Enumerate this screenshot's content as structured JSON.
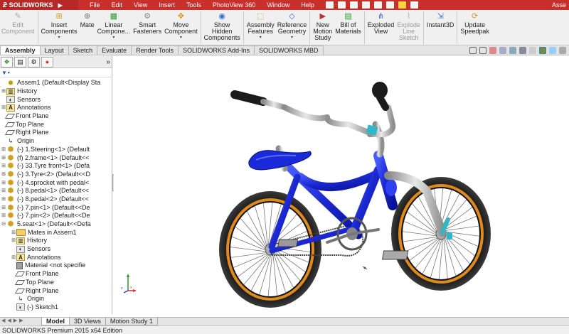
{
  "app": {
    "logo": "SOLIDWORKS",
    "title_right": "Asse"
  },
  "menus": [
    "File",
    "Edit",
    "View",
    "Insert",
    "Tools",
    "PhotoView 360",
    "Window",
    "Help"
  ],
  "commands": [
    {
      "id": "edit-component",
      "label": "Edit\nComponent",
      "disabled": true,
      "icon": "edit-component-icon"
    },
    {
      "id": "insert-components",
      "label": "Insert\nComponents",
      "disabled": false,
      "icon": "insert-components-icon",
      "dropdown": true
    },
    {
      "id": "mate",
      "label": "Mate",
      "disabled": false,
      "icon": "mate-icon"
    },
    {
      "id": "linear-component",
      "label": "Linear\nCompone...",
      "disabled": false,
      "icon": "linear-pattern-icon",
      "dropdown": true
    },
    {
      "id": "smart-fasteners",
      "label": "Smart\nFasteners",
      "disabled": false,
      "icon": "smart-fasteners-icon"
    },
    {
      "id": "move-component",
      "label": "Move\nComponent",
      "disabled": false,
      "icon": "move-component-icon",
      "dropdown": true
    },
    {
      "id": "show-hidden",
      "label": "Show\nHidden\nComponents",
      "disabled": false,
      "icon": "show-hidden-icon"
    },
    {
      "id": "assembly-features",
      "label": "Assembly\nFeatures",
      "disabled": false,
      "icon": "assembly-features-icon",
      "dropdown": true
    },
    {
      "id": "reference-geometry",
      "label": "Reference\nGeometry",
      "disabled": false,
      "icon": "reference-geometry-icon",
      "dropdown": true
    },
    {
      "id": "new-motion-study",
      "label": "New\nMotion\nStudy",
      "disabled": false,
      "icon": "motion-study-icon"
    },
    {
      "id": "bill-of-materials",
      "label": "Bill of\nMaterials",
      "disabled": false,
      "icon": "bom-icon"
    },
    {
      "id": "exploded-view",
      "label": "Exploded\nView",
      "disabled": false,
      "icon": "exploded-view-icon"
    },
    {
      "id": "explode-line-sketch",
      "label": "Explode\nLine\nSketch",
      "disabled": true,
      "icon": "explode-line-icon"
    },
    {
      "id": "instant3d",
      "label": "Instant3D",
      "disabled": false,
      "icon": "instant3d-icon"
    },
    {
      "id": "update-speedpak",
      "label": "Update\nSpeedpak",
      "disabled": false,
      "icon": "speedpak-icon"
    }
  ],
  "tabs": [
    "Assembly",
    "Layout",
    "Sketch",
    "Evaluate",
    "Render Tools",
    "SOLIDWORKS Add-Ins",
    "SOLIDWORKS MBD"
  ],
  "active_tab": "Assembly",
  "tree": [
    {
      "indent": 0,
      "twisty": "",
      "icon": "asm",
      "label": "Assem1  (Default<Display Sta"
    },
    {
      "indent": 0,
      "twisty": "+",
      "icon": "hist",
      "label": "History"
    },
    {
      "indent": 0,
      "twisty": "",
      "icon": "sens",
      "label": "Sensors"
    },
    {
      "indent": 0,
      "twisty": "+",
      "icon": "anno",
      "label": "Annotations"
    },
    {
      "indent": 0,
      "twisty": "",
      "icon": "plane",
      "label": "Front Plane"
    },
    {
      "indent": 0,
      "twisty": "",
      "icon": "plane",
      "label": "Top Plane"
    },
    {
      "indent": 0,
      "twisty": "",
      "icon": "plane",
      "label": "Right Plane"
    },
    {
      "indent": 0,
      "twisty": "",
      "icon": "orig",
      "label": "Origin"
    },
    {
      "indent": 0,
      "twisty": "+",
      "icon": "part",
      "label": "(-) 1.Steering<1> (Default"
    },
    {
      "indent": 0,
      "twisty": "+",
      "icon": "part",
      "label": "(f) 2.frame<1> (Default<<"
    },
    {
      "indent": 0,
      "twisty": "+",
      "icon": "part",
      "label": "(-) 33.Tyre front<1> (Defa"
    },
    {
      "indent": 0,
      "twisty": "+",
      "icon": "part",
      "label": "(-) 3.Tyre<2> (Default<<D"
    },
    {
      "indent": 0,
      "twisty": "+",
      "icon": "part",
      "label": "(-) 4.sprocket with pedal<"
    },
    {
      "indent": 0,
      "twisty": "+",
      "icon": "part",
      "label": "(-) 8.pedal<1> (Default<<"
    },
    {
      "indent": 0,
      "twisty": "+",
      "icon": "part",
      "label": "(-) 8.pedal<2> (Default<<"
    },
    {
      "indent": 0,
      "twisty": "+",
      "icon": "part",
      "label": "(-) 7.pin<1> (Default<<De"
    },
    {
      "indent": 0,
      "twisty": "+",
      "icon": "part",
      "label": "(-) 7.pin<2> (Default<<De"
    },
    {
      "indent": 0,
      "twisty": "-",
      "icon": "part",
      "label": "5.seat<1> (Default<<Defa"
    },
    {
      "indent": 1,
      "twisty": "+",
      "icon": "folder",
      "label": "Mates in Assem1"
    },
    {
      "indent": 1,
      "twisty": "+",
      "icon": "hist",
      "label": "History"
    },
    {
      "indent": 1,
      "twisty": "",
      "icon": "sens",
      "label": "Sensors"
    },
    {
      "indent": 1,
      "twisty": "+",
      "icon": "anno",
      "label": "Annotations"
    },
    {
      "indent": 1,
      "twisty": "",
      "icon": "mat",
      "label": "Material <not specifie"
    },
    {
      "indent": 1,
      "twisty": "",
      "icon": "plane",
      "label": "Front Plane"
    },
    {
      "indent": 1,
      "twisty": "",
      "icon": "plane",
      "label": "Top Plane"
    },
    {
      "indent": 1,
      "twisty": "",
      "icon": "plane",
      "label": "Right Plane"
    },
    {
      "indent": 1,
      "twisty": "",
      "icon": "orig",
      "label": "Origin"
    },
    {
      "indent": 1,
      "twisty": "",
      "icon": "sens",
      "label": "(-) Sketch1"
    }
  ],
  "bottom_tabs": [
    "Model",
    "3D Views",
    "Motion Study 1"
  ],
  "active_bottom_tab": "Model",
  "status": "SOLIDWORKS Premium 2015 x64 Edition",
  "colors": {
    "title_red": "#c9302c",
    "frame_blue": "#1d2fd6",
    "tyre_black": "#1b1b1b",
    "rim_orange": "#e08a1e",
    "fork_silver": "#b9b9b9",
    "accent_cyan": "#2fb8c8"
  }
}
